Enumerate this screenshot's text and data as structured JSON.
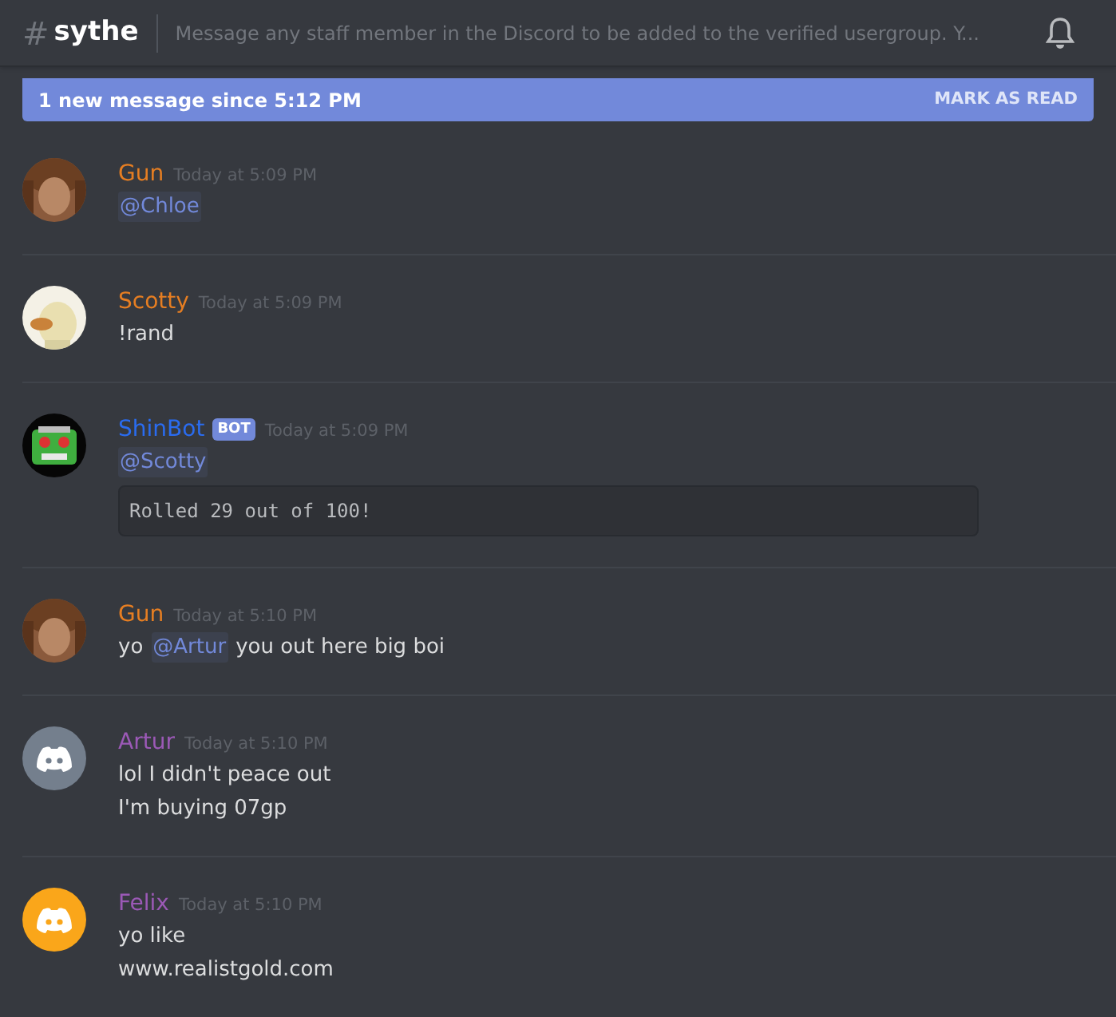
{
  "header": {
    "hash": "#",
    "channel": "sythe",
    "topic": "Message any staff member in the Discord to be added to the verified usergroup. Y..."
  },
  "banner": {
    "text": "1 new message since 5:12 PM",
    "action": "MARK AS READ"
  },
  "messages": [
    {
      "author": "Gun",
      "color": "#e67e22",
      "avatar": {
        "kind": "picture"
      },
      "time": "Today at 5:09 PM",
      "lines": [
        [
          {
            "kind": "mention",
            "text": "@Chloe"
          }
        ]
      ]
    },
    {
      "author": "Scotty",
      "color": "#e67e22",
      "avatar": {
        "kind": "picture"
      },
      "time": "Today at 5:09 PM",
      "lines": [
        [
          {
            "kind": "text",
            "text": "!rand"
          }
        ]
      ]
    },
    {
      "author": "ShinBot",
      "color": "#2a6cf0",
      "avatar": {
        "kind": "picture"
      },
      "badge": "BOT",
      "time": "Today at 5:09 PM",
      "lines": [
        [
          {
            "kind": "mention",
            "text": "@Scotty"
          }
        ]
      ],
      "code": "Rolled 29 out of 100!"
    },
    {
      "author": "Gun",
      "color": "#e67e22",
      "avatar": {
        "kind": "picture"
      },
      "time": "Today at 5:10 PM",
      "lines": [
        [
          {
            "kind": "text",
            "text": "yo"
          },
          {
            "kind": "mention",
            "text": "@Artur"
          },
          {
            "kind": "text",
            "text": "you out here big boi"
          }
        ]
      ]
    },
    {
      "author": "Artur",
      "color": "#9b59b6",
      "avatar": {
        "kind": "default",
        "color": "#747f8d"
      },
      "time": "Today at 5:10 PM",
      "lines": [
        [
          {
            "kind": "text",
            "text": "lol I didn't peace out"
          }
        ],
        [
          {
            "kind": "text",
            "text": "I'm buying 07gp"
          }
        ]
      ]
    },
    {
      "author": "Felix",
      "color": "#9b59b6",
      "avatar": {
        "kind": "default",
        "color": "#faa61a"
      },
      "time": "Today at 5:10 PM",
      "lines": [
        [
          {
            "kind": "text",
            "text": "yo like"
          }
        ],
        [
          {
            "kind": "text",
            "text": "www.realistgold.com"
          }
        ]
      ]
    }
  ]
}
